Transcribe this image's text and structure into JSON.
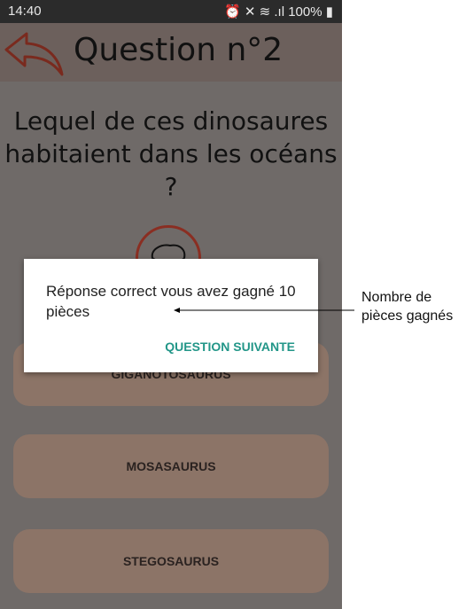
{
  "status_bar": {
    "time": "14:40",
    "right": "⏰ ✕ ≋ .ıl 100% ▮"
  },
  "header": {
    "title": "Question n°2"
  },
  "question": "Lequel de ces dinosaures habitaient dans les océans ?",
  "answers": [
    "GIGANOTOSAURUS",
    "MOSASAURUS",
    "STEGOSAURUS"
  ],
  "dialog": {
    "message": "Réponse correct vous avez gagné 10 pièces",
    "button": "QUESTION SUIVANTE"
  },
  "annotation": "Nombre de pièces gagnés"
}
